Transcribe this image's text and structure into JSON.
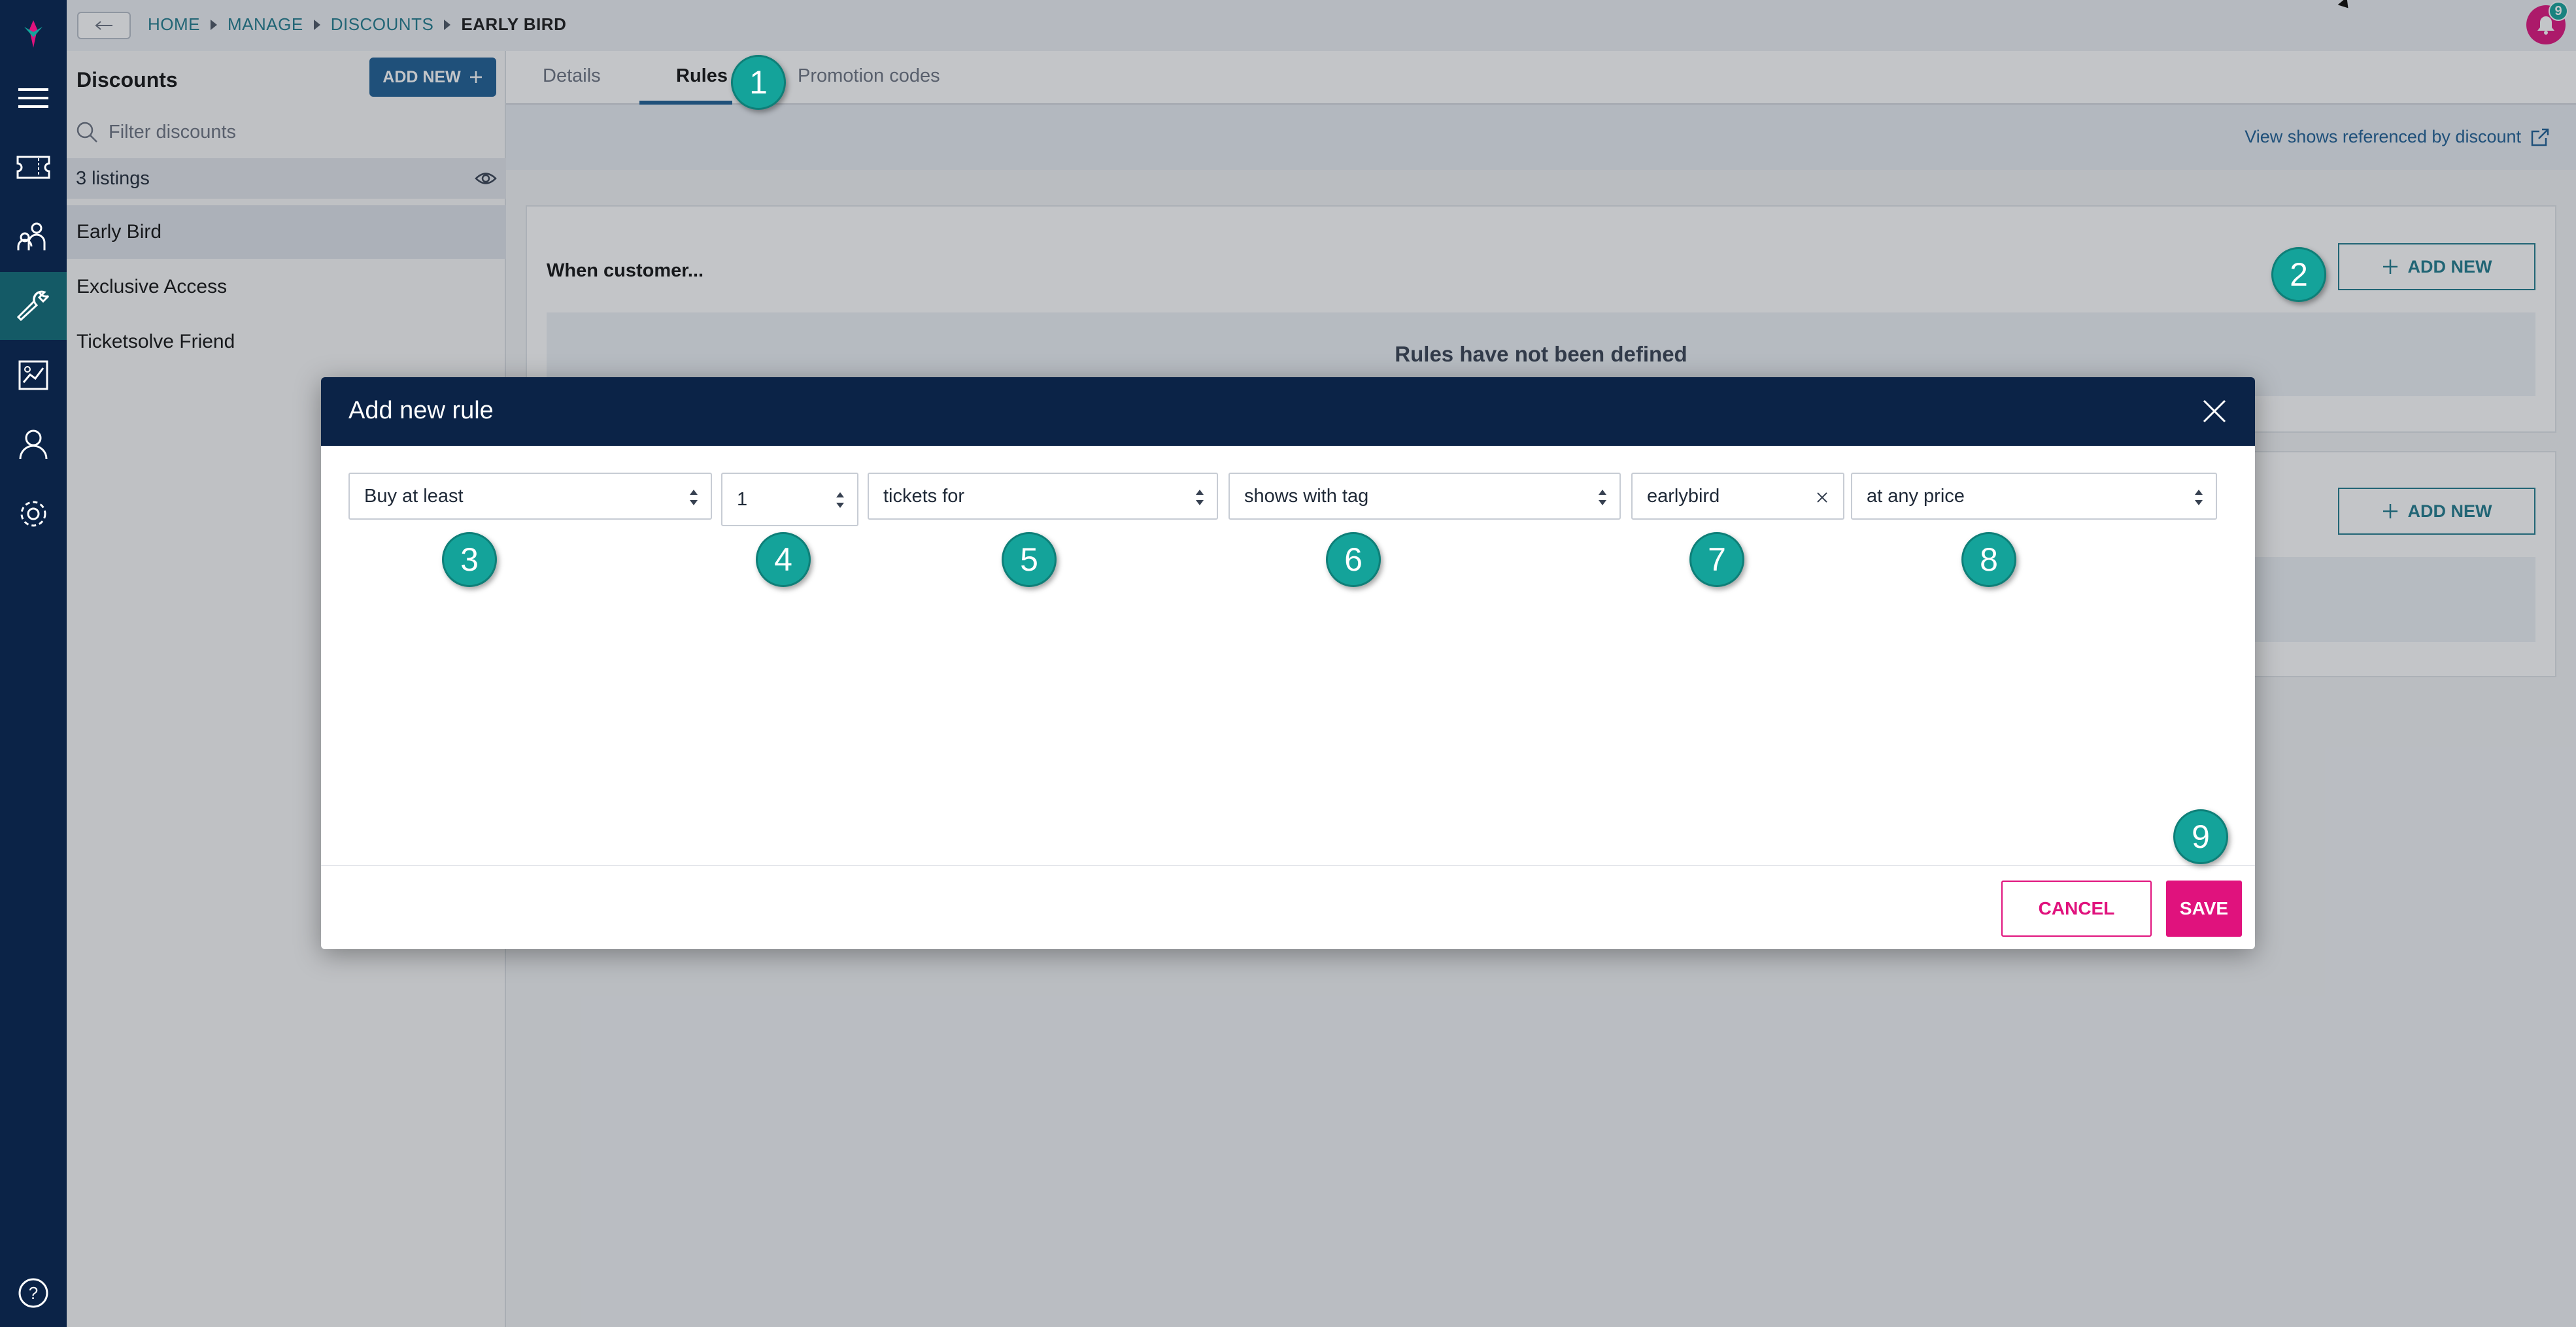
{
  "app": {
    "brand_color": "#e0127d",
    "nav_color": "#0b2347",
    "accent_teal": "#14a39a",
    "primary_blue": "#1d5e93"
  },
  "rail": {
    "items": [
      "logo-icon",
      "menu-icon",
      "tickets-icon",
      "people-icon",
      "wrench-icon",
      "report-icon",
      "user-icon",
      "settings-icon",
      "help-icon"
    ]
  },
  "breadcrumb": {
    "items": [
      "HOME",
      "MANAGE",
      "DISCOUNTS"
    ],
    "current": "EARLY BIRD"
  },
  "notifications": {
    "count": "9"
  },
  "sidebar": {
    "title": "Discounts",
    "add_new_label": "ADD NEW",
    "filter_placeholder": "Filter discounts",
    "listing_count": "3 listings",
    "items": [
      {
        "label": "Early Bird",
        "selected": true
      },
      {
        "label": "Exclusive Access",
        "selected": false
      },
      {
        "label": "Ticketsolve Friend",
        "selected": false
      }
    ]
  },
  "main": {
    "tabs": [
      {
        "label": "Details",
        "active": false
      },
      {
        "label": "Rules",
        "active": true
      },
      {
        "label": "Promotion codes",
        "active": false
      }
    ],
    "view_shows_link": "View shows referenced by discount",
    "when_label": "When customer...",
    "add_new_label": "ADD NEW",
    "empty_rules": "Rules have not been defined",
    "add_new_label_2": "ADD NEW"
  },
  "modal": {
    "title": "Add new rule",
    "fields": {
      "condition": "Buy at least",
      "quantity": "1",
      "target": "tickets for",
      "scope": "shows with tag",
      "tag": "earlybird",
      "price": "at any price"
    },
    "cancel_label": "CANCEL",
    "save_label": "SAVE"
  },
  "markers": [
    "1",
    "2",
    "3",
    "4",
    "5",
    "6",
    "7",
    "8",
    "9"
  ]
}
